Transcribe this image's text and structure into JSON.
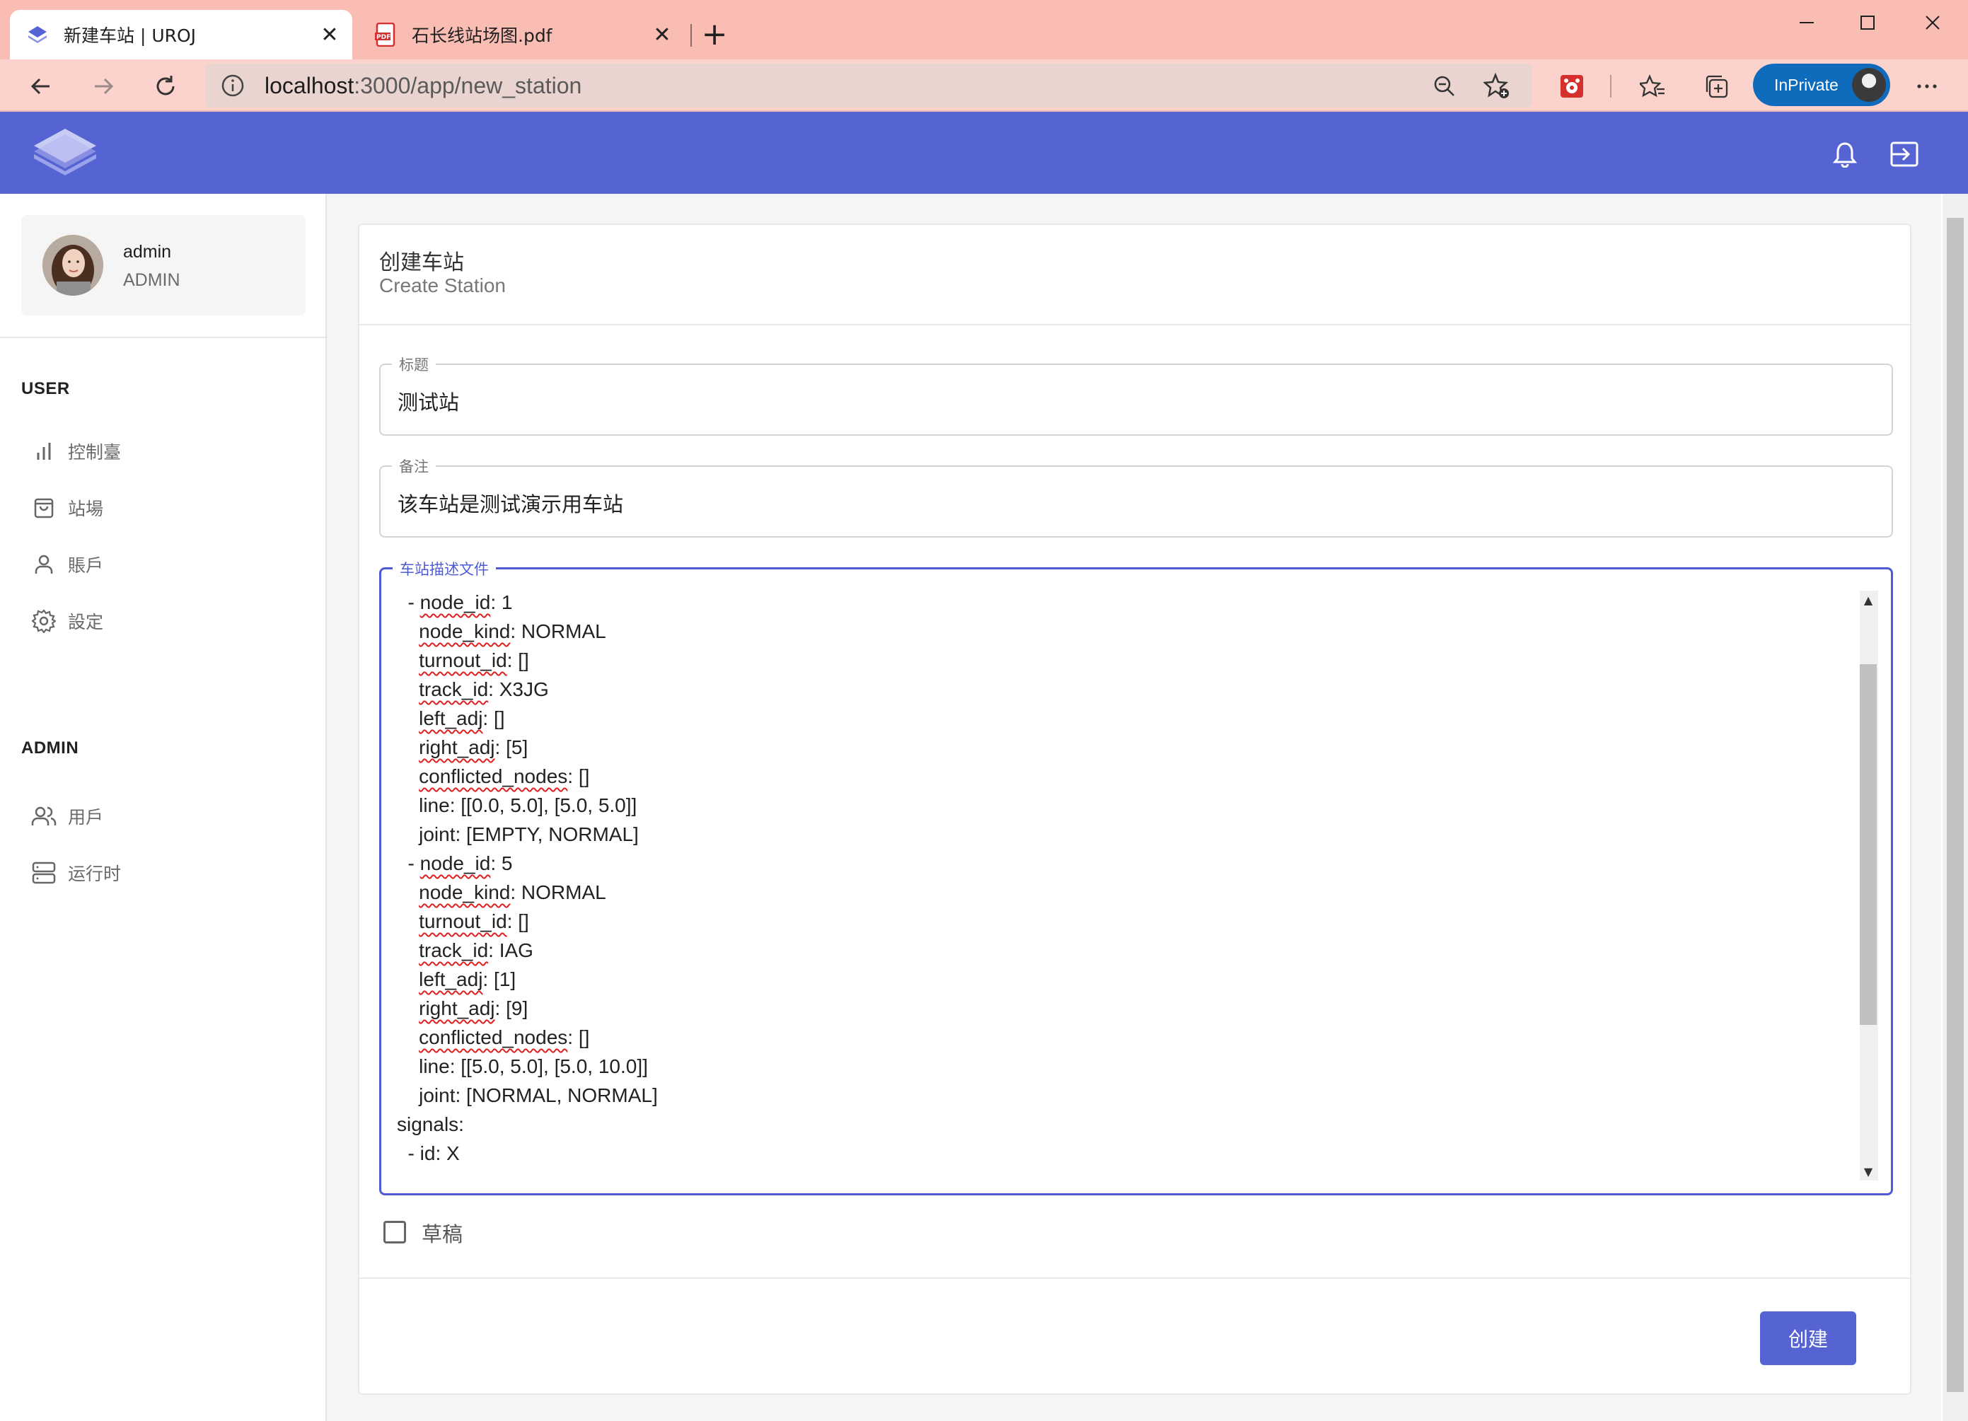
{
  "browser": {
    "tabs": [
      {
        "title": "新建车站 | UROJ",
        "icon": "layers-icon",
        "active": true
      },
      {
        "title": "石长线站场图.pdf",
        "icon": "pdf-icon",
        "active": false
      }
    ],
    "url_host": "localhost",
    "url_path": ":3000/app/new_station",
    "inprivate_label": "InPrivate"
  },
  "user": {
    "name": "admin",
    "role": "ADMIN"
  },
  "sidebar": {
    "user_section": "USER",
    "user_items": [
      {
        "label": "控制臺",
        "icon": "bar-chart-icon"
      },
      {
        "label": "站場",
        "icon": "shopping-bag-icon"
      },
      {
        "label": "賬戶",
        "icon": "user-icon"
      },
      {
        "label": "設定",
        "icon": "gear-icon"
      }
    ],
    "admin_section": "ADMIN",
    "admin_items": [
      {
        "label": "用戶",
        "icon": "users-icon"
      },
      {
        "label": "运行时",
        "icon": "server-icon"
      }
    ]
  },
  "form": {
    "title": "创建车站",
    "subtitle": "Create Station",
    "title_field": {
      "label": "标题",
      "value": "测试站"
    },
    "note_field": {
      "label": "备注",
      "value": "该车站是测试演示用车站"
    },
    "file_field": {
      "label": "车站描述文件",
      "lines": [
        "  - node_id: 1",
        "    node_kind: NORMAL",
        "    turnout_id: []",
        "    track_id: X3JG",
        "    left_adj: []",
        "    right_adj: [5]",
        "    conflicted_nodes: []",
        "    line: [[0.0, 5.0], [5.0, 5.0]]",
        "    joint: [EMPTY, NORMAL]",
        "  - node_id: 5",
        "    node_kind: NORMAL",
        "    turnout_id: []",
        "    track_id: IAG",
        "    left_adj: [1]",
        "    right_adj: [9]",
        "    conflicted_nodes: []",
        "    line: [[5.0, 5.0], [5.0, 10.0]]",
        "    joint: [NORMAL, NORMAL]",
        "signals:",
        "  - id: X"
      ]
    },
    "draft_label": "草稿",
    "draft_checked": false,
    "submit_label": "创建"
  },
  "colors": {
    "primary": "#5563d3",
    "tab_bar": "#f9bdb4",
    "inprivate": "#0f6cbd"
  }
}
